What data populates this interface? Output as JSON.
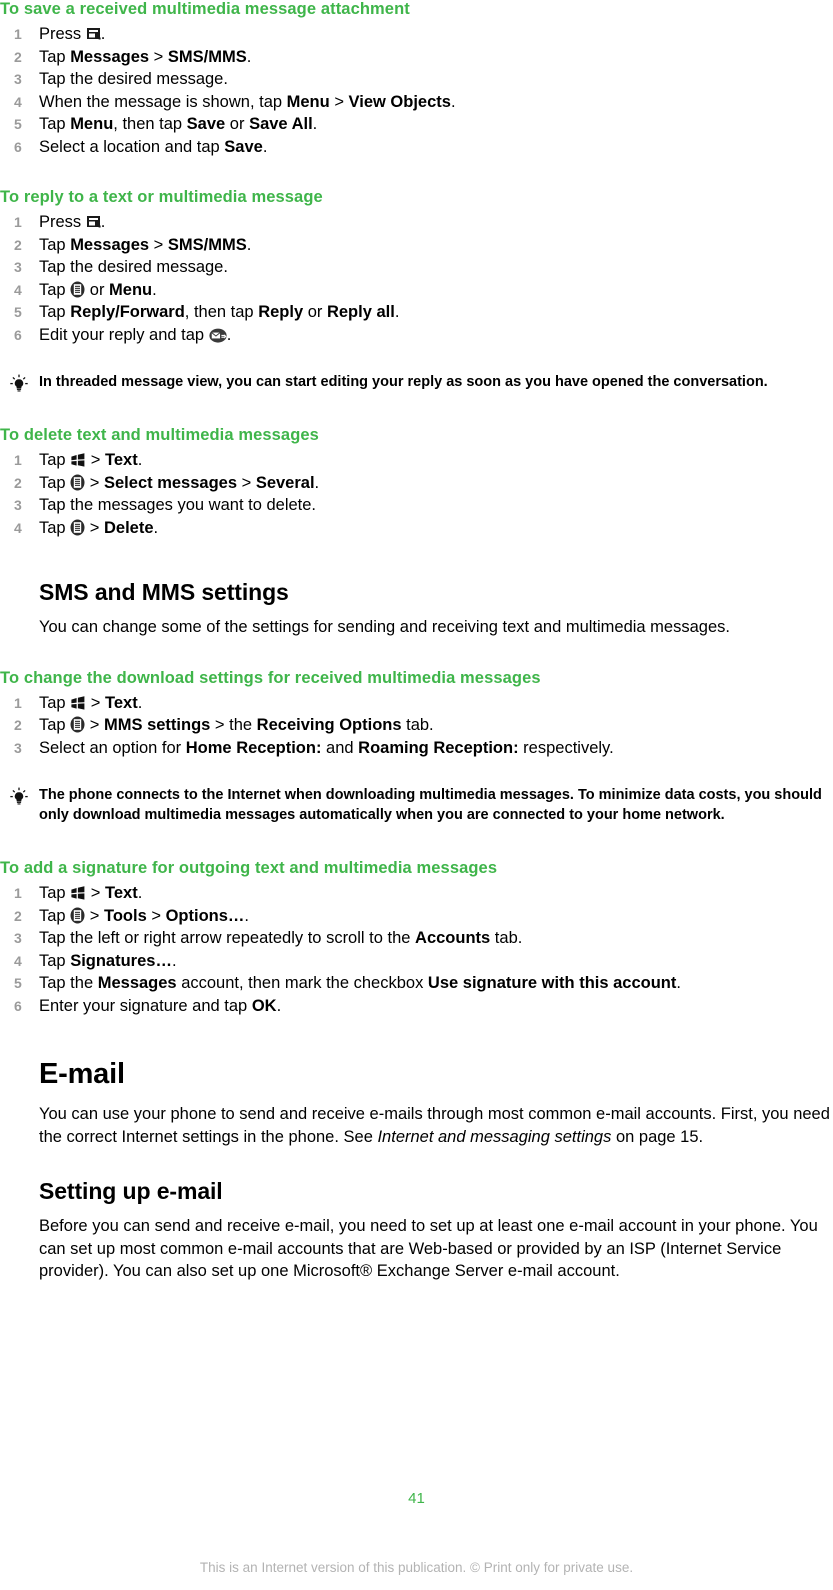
{
  "document": {
    "page_number": "41",
    "footer_note": "This is an Internet version of this publication. © Print only for private use.",
    "accent_color": "#3FB54A",
    "step_number_color": "#9A9A9A"
  },
  "procedures": {
    "save_attachment": {
      "heading": "To save a received multimedia message attachment",
      "steps": [
        {
          "num": "1",
          "pre": "Press ",
          "icon": "phone-display-icon",
          "post": "."
        },
        {
          "num": "2",
          "pre": "Tap ",
          "bold1": "Messages",
          "sep": " > ",
          "bold2": "SMS/MMS",
          "post": "."
        },
        {
          "num": "3",
          "pre": "Tap the desired message."
        },
        {
          "num": "4",
          "pre": "When the message is shown, tap ",
          "bold1": "Menu",
          "sep": " > ",
          "bold2": "View Objects",
          "post": "."
        },
        {
          "num": "5",
          "pre": "Tap ",
          "bold1": "Menu",
          "mid": ", then tap ",
          "bold2": "Save",
          "mid2": " or ",
          "bold3": "Save All",
          "post": "."
        },
        {
          "num": "6",
          "pre": "Select a location and tap ",
          "bold1": "Save",
          "post": "."
        }
      ]
    },
    "reply_message": {
      "heading": "To reply to a text or multimedia message",
      "steps": [
        {
          "num": "1",
          "pre": "Press ",
          "icon": "phone-display-icon",
          "post": "."
        },
        {
          "num": "2",
          "pre": "Tap ",
          "bold1": "Messages",
          "sep": " > ",
          "bold2": "SMS/MMS",
          "post": "."
        },
        {
          "num": "3",
          "pre": "Tap the desired message."
        },
        {
          "num": "4",
          "pre": "Tap ",
          "icon": "menu-list-icon",
          "mid": " or ",
          "bold1": "Menu",
          "post": "."
        },
        {
          "num": "5",
          "pre": "Tap ",
          "bold1": "Reply/Forward",
          "mid": ", then tap ",
          "bold2": "Reply",
          "mid2": " or ",
          "bold3": "Reply all",
          "post": "."
        },
        {
          "num": "6",
          "pre": "Edit your reply and tap ",
          "icon": "send-envelope-icon",
          "post": "."
        }
      ],
      "tip": "In threaded message view, you can start editing your reply as soon as you have opened the conversation."
    },
    "delete_messages": {
      "heading": "To delete text and multimedia messages",
      "steps": [
        {
          "num": "1",
          "pre": "Tap ",
          "icon": "start-windows-icon",
          "sep": " > ",
          "bold2": "Text",
          "post": "."
        },
        {
          "num": "2",
          "pre": "Tap ",
          "icon": "menu-list-icon",
          "sep": " > ",
          "bold2": "Select messages",
          "sep2": " > ",
          "bold3": "Several",
          "post": "."
        },
        {
          "num": "3",
          "pre": "Tap the messages you want to delete."
        },
        {
          "num": "4",
          "pre": "Tap ",
          "icon": "menu-list-icon",
          "sep": " > ",
          "bold2": "Delete",
          "post": "."
        }
      ]
    },
    "download_settings": {
      "heading": "To change the download settings for received multimedia messages",
      "steps": [
        {
          "num": "1",
          "pre": "Tap ",
          "icon": "start-windows-icon",
          "sep": " > ",
          "bold2": "Text",
          "post": "."
        },
        {
          "num": "2",
          "pre": "Tap ",
          "icon": "menu-list-icon",
          "sep": " > ",
          "bold2": "MMS settings",
          "sep2": " > the ",
          "bold3": "Receiving Options",
          "post": " tab."
        },
        {
          "num": "3",
          "pre": "Select an option for ",
          "bold1": "Home Reception:",
          "mid": " and ",
          "bold2": "Roaming Reception:",
          "post": " respectively."
        }
      ],
      "tip": "The phone connects to the Internet when downloading multimedia messages. To minimize data costs, you should only download multimedia messages automatically when you are connected to your home network."
    },
    "add_signature": {
      "heading": "To add a signature for outgoing text and multimedia messages",
      "steps": [
        {
          "num": "1",
          "pre": "Tap ",
          "icon": "start-windows-icon",
          "sep": " > ",
          "bold2": "Text",
          "post": "."
        },
        {
          "num": "2",
          "pre": "Tap ",
          "icon": "menu-list-icon",
          "sep": " > ",
          "bold2": "Tools",
          "sep2": " > ",
          "bold3": "Options…",
          "post": "."
        },
        {
          "num": "3",
          "pre": "Tap the left or right arrow repeatedly to scroll to the ",
          "bold1": "Accounts",
          "post": " tab."
        },
        {
          "num": "4",
          "pre": "Tap ",
          "bold1": "Signatures…",
          "post": "."
        },
        {
          "num": "5",
          "pre": "Tap the ",
          "bold1": "Messages",
          "mid": " account, then mark the checkbox ",
          "bold2": "Use signature with this account",
          "post": "."
        },
        {
          "num": "6",
          "pre": "Enter your signature and tap ",
          "bold1": "OK",
          "post": "."
        }
      ]
    }
  },
  "sections": {
    "sms_mms_settings": {
      "heading": "SMS and MMS settings",
      "body": "You can change some of the settings for sending and receiving text and multimedia messages."
    },
    "email": {
      "heading": "E-mail",
      "body_pre": "You can use your phone to send and receive e-mails through most common e-mail accounts. First, you need the correct Internet settings in the phone. See ",
      "body_italic": "Internet and messaging settings",
      "body_post": " on page 15."
    },
    "setting_up_email": {
      "heading": "Setting up e-mail",
      "body": "Before you can send and receive e-mail, you need to set up at least one e-mail account in your phone. You can set up most common e-mail accounts that are Web-based or provided by an ISP (Internet Service provider). You can also set up one Microsoft® Exchange Server e-mail account."
    }
  }
}
